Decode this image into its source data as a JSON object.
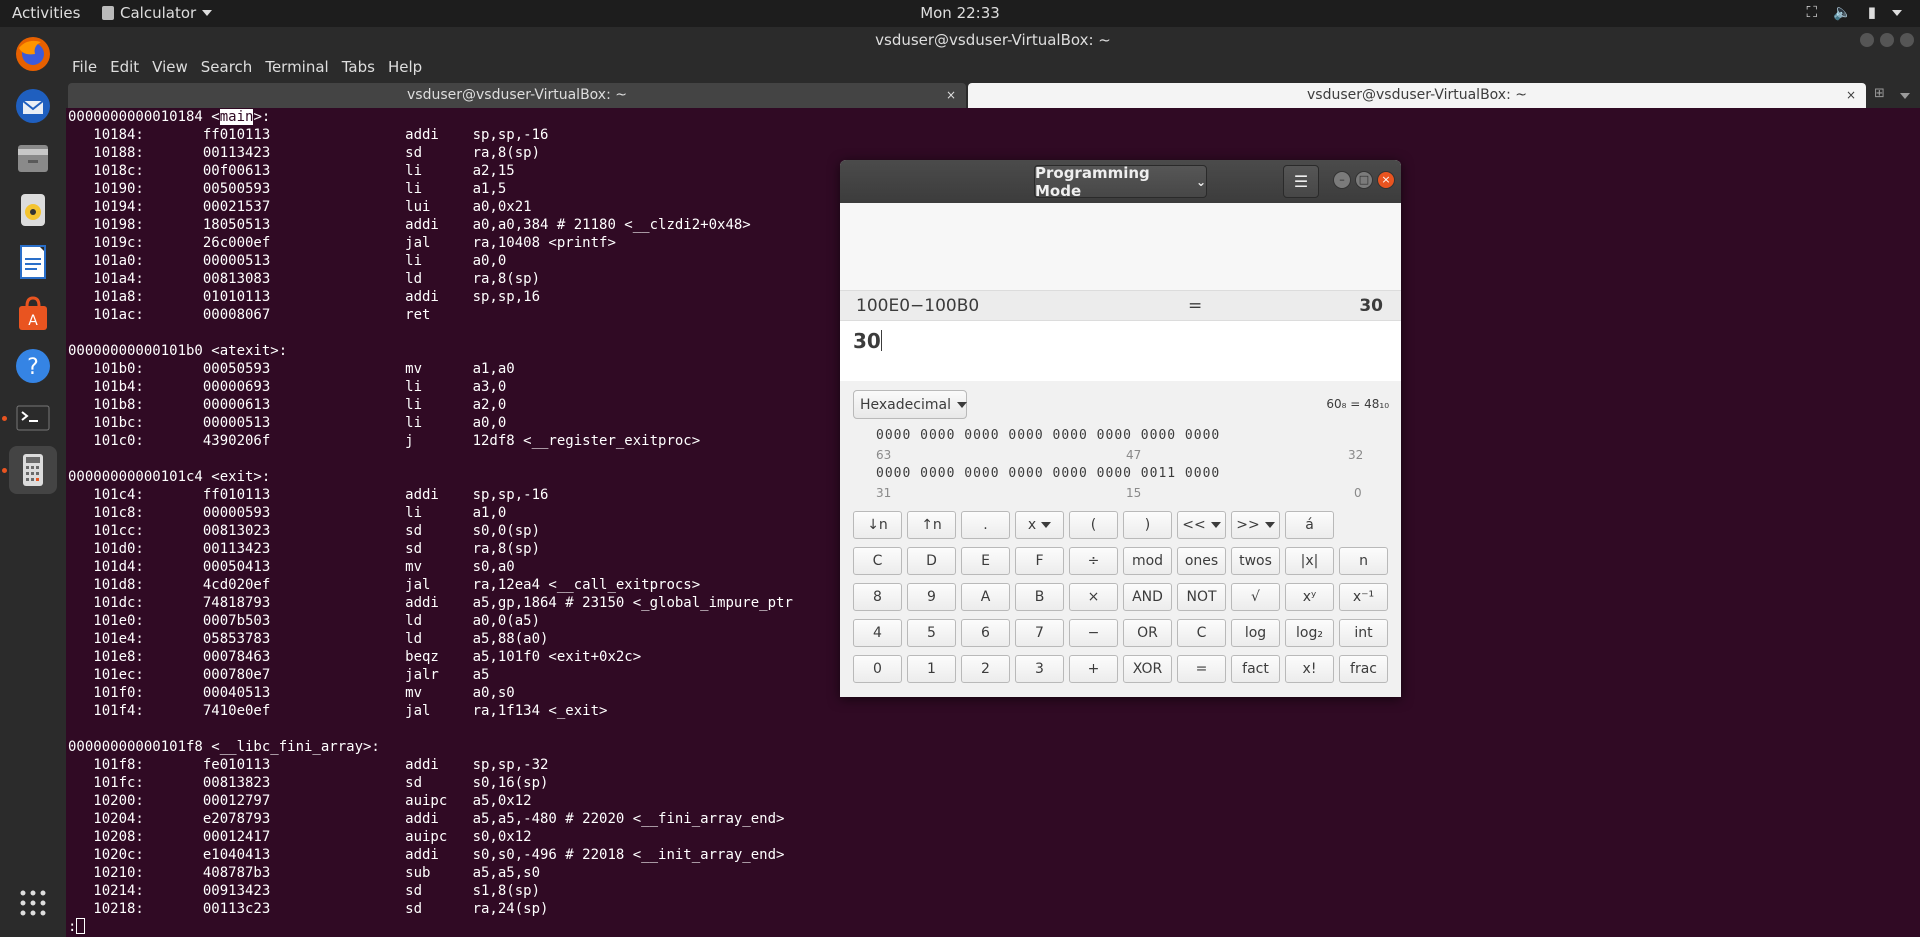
{
  "topbar": {
    "activities": "Activities",
    "app_name": "Calculator",
    "clock": "Mon 22:33"
  },
  "terminal": {
    "title": "vsduser@vsduser-VirtualBox: ~",
    "menu": [
      "File",
      "Edit",
      "View",
      "Search",
      "Terminal",
      "Tabs",
      "Help"
    ],
    "tabs": [
      {
        "label": "vsduser@vsduser-VirtualBox: ~",
        "active": false
      },
      {
        "label": "vsduser@vsduser-VirtualBox: ~",
        "active": true
      }
    ],
    "close_glyph": "×",
    "highlight_word": "main",
    "lines": [
      "0000000000010184 <main>:",
      "   10184:       ff010113                addi    sp,sp,-16",
      "   10188:       00113423                sd      ra,8(sp)",
      "   1018c:       00f00613                li      a2,15",
      "   10190:       00500593                li      a1,5",
      "   10194:       00021537                lui     a0,0x21",
      "   10198:       18050513                addi    a0,a0,384 # 21180 <__clzdi2+0x48>",
      "   1019c:       26c000ef                jal     ra,10408 <printf>",
      "   101a0:       00000513                li      a0,0",
      "   101a4:       00813083                ld      ra,8(sp)",
      "   101a8:       01010113                addi    sp,sp,16",
      "   101ac:       00008067                ret",
      "",
      "00000000000101b0 <atexit>:",
      "   101b0:       00050593                mv      a1,a0",
      "   101b4:       00000693                li      a3,0",
      "   101b8:       00000613                li      a2,0",
      "   101bc:       00000513                li      a0,0",
      "   101c0:       4390206f                j       12df8 <__register_exitproc>",
      "",
      "00000000000101c4 <exit>:",
      "   101c4:       ff010113                addi    sp,sp,-16",
      "   101c8:       00000593                li      a1,0",
      "   101cc:       00813023                sd      s0,0(sp)",
      "   101d0:       00113423                sd      ra,8(sp)",
      "   101d4:       00050413                mv      s0,a0",
      "   101d8:       4cd020ef                jal     ra,12ea4 <__call_exitprocs>",
      "   101dc:       74818793                addi    a5,gp,1864 # 23150 <_global_impure_ptr",
      "   101e0:       0007b503                ld      a0,0(a5)",
      "   101e4:       05853783                ld      a5,88(a0)",
      "   101e8:       00078463                beqz    a5,101f0 <exit+0x2c>",
      "   101ec:       000780e7                jalr    a5",
      "   101f0:       00040513                mv      a0,s0",
      "   101f4:       7410e0ef                jal     ra,1f134 <_exit>",
      "",
      "00000000000101f8 <__libc_fini_array>:",
      "   101f8:       fe010113                addi    sp,sp,-32",
      "   101fc:       00813823                sd      s0,16(sp)",
      "   10200:       00012797                auipc   a5,0x12",
      "   10204:       e2078793                addi    a5,a5,-480 # 22020 <__fini_array_end>",
      "   10208:       00012417                auipc   s0,0x12",
      "   1020c:       e1040413                addi    s0,s0,-496 # 22018 <__init_array_end>",
      "   10210:       408787b3                sub     a5,a5,s0",
      "   10214:       00913423                sd      s1,8(sp)",
      "   10218:       00113c23                sd      ra,24(sp)"
    ],
    "prompt": ":"
  },
  "calculator": {
    "mode": "Programming Mode",
    "history_expr": "100E0−100B0",
    "history_eq": "=",
    "history_result": "30",
    "entry": "30",
    "base": "Hexadecimal",
    "conversion": "60₈ = 48₁₀",
    "bits_row1": "0000  0000  0000  0000  0000  0000  0000  0000",
    "bits_row1_labels": [
      "63",
      "47",
      "32"
    ],
    "bits_row2": "0000  0000  0000  0000  0000  0000  0011  0000",
    "bits_row2_labels": [
      "31",
      "15",
      "0"
    ],
    "buttons": [
      [
        {
          "label": "↓n"
        },
        {
          "label": "↑n"
        },
        {
          "label": "."
        },
        {
          "label": "x",
          "dropdown": true
        },
        {
          "label": "("
        },
        {
          "label": ")"
        },
        {
          "label": "<<",
          "dropdown": true
        },
        {
          "label": ">>",
          "dropdown": true
        },
        {
          "label": "á"
        }
      ],
      [
        {
          "label": "C"
        },
        {
          "label": "D"
        },
        {
          "label": "E"
        },
        {
          "label": "F"
        },
        {
          "label": "÷"
        },
        {
          "label": "mod"
        },
        {
          "label": "ones"
        },
        {
          "label": "twos"
        },
        {
          "label": "|x|"
        },
        {
          "label": "n"
        }
      ],
      [
        {
          "label": "8"
        },
        {
          "label": "9"
        },
        {
          "label": "A"
        },
        {
          "label": "B"
        },
        {
          "label": "×"
        },
        {
          "label": "AND"
        },
        {
          "label": "NOT"
        },
        {
          "label": "√"
        },
        {
          "label": "xʸ"
        },
        {
          "label": "x⁻¹"
        }
      ],
      [
        {
          "label": "4"
        },
        {
          "label": "5"
        },
        {
          "label": "6"
        },
        {
          "label": "7"
        },
        {
          "label": "−"
        },
        {
          "label": "OR"
        },
        {
          "label": "C"
        },
        {
          "label": "log"
        },
        {
          "label": "log₂"
        },
        {
          "label": "int"
        }
      ],
      [
        {
          "label": "0"
        },
        {
          "label": "1"
        },
        {
          "label": "2"
        },
        {
          "label": "3"
        },
        {
          "label": "+"
        },
        {
          "label": "XOR"
        },
        {
          "label": "="
        },
        {
          "label": "fact"
        },
        {
          "label": "x!"
        },
        {
          "label": "frac"
        }
      ]
    ]
  },
  "dock": {
    "items": [
      "firefox-icon",
      "thunderbird-icon",
      "files-icon",
      "rhythmbox-icon",
      "writer-icon",
      "software-icon",
      "help-icon",
      "terminal-icon",
      "calculator-icon"
    ],
    "show_apps": "apps-grid-icon"
  },
  "colors": {
    "terminal_bg": "#300a24",
    "accent": "#e95420"
  }
}
